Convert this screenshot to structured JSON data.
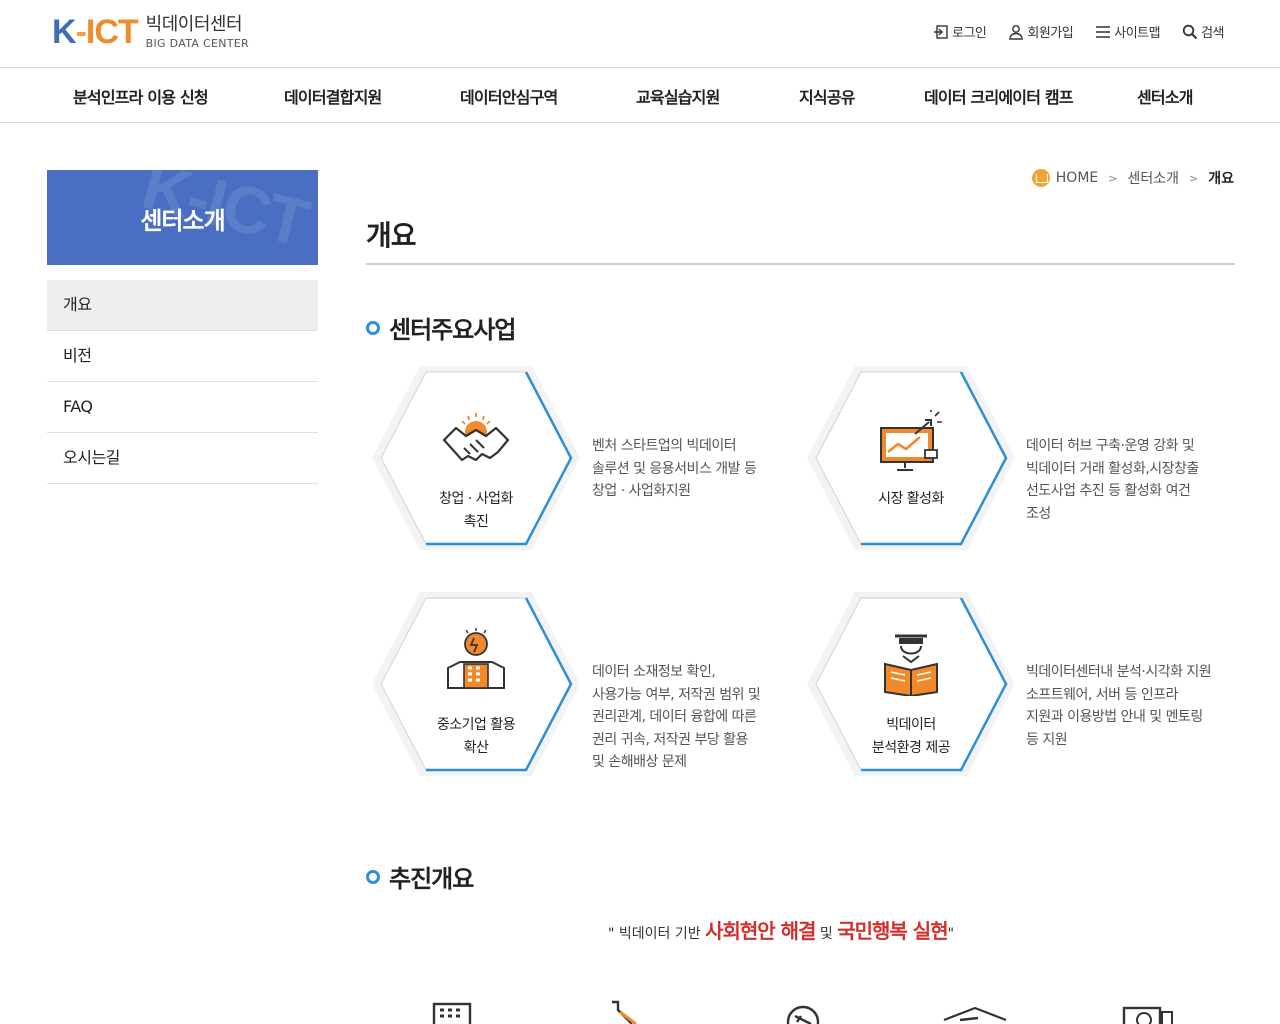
{
  "header": {
    "logo_mark": {
      "k": "K",
      "dash": "-",
      "ict": "ICT"
    },
    "logo_ko": "빅데이터센터",
    "logo_en": "BIG DATA CENTER",
    "util": [
      {
        "label": "로그인",
        "icon": "login-icon"
      },
      {
        "label": "회원가입",
        "icon": "user-icon"
      },
      {
        "label": "사이트맵",
        "icon": "menu-icon"
      },
      {
        "label": "검색",
        "icon": "search-icon"
      }
    ]
  },
  "gnb": [
    "분석인프라 이용 신청",
    "데이터결합지원",
    "데이터안심구역",
    "교육실습지원",
    "지식공유",
    "데이터 크리에이터 캠프",
    "센터소개"
  ],
  "sidebar": {
    "title": "센터소개",
    "watermark": "K-ICT",
    "items": [
      "개요",
      "비전",
      "FAQ",
      "오시는길"
    ]
  },
  "breadcrumb": {
    "home": "HOME",
    "parent": "센터소개",
    "current": "개요"
  },
  "page_title": "개요",
  "section1": {
    "title": "센터주요사업",
    "cards": [
      {
        "label1": "창업 · 사업화",
        "label2": "촉진",
        "icon": "handshake-icon",
        "desc": [
          "벤처 스타트업의 빅데이터",
          "솔루션 및 응용서비스 개발 등",
          "창업 · 사업화지원"
        ]
      },
      {
        "label1": "시장 활성화",
        "label2": "",
        "icon": "growth-chart-icon",
        "desc": [
          "데이터 허브 구축·운영 강화 및",
          "빅데이터 거래 활성화,시장창출",
          "선도사업 추진 등 활성화 여건",
          "조성"
        ]
      },
      {
        "label1": "중소기업 활용",
        "label2": "확산",
        "icon": "building-idea-icon",
        "desc": [
          "데이터 소재정보 확인,",
          "사용가능 여부, 저작권 범위 및",
          "권리관계, 데이터 융합에 따른",
          "권리 귀속, 저작권 부당 활용",
          "및 손해배상 문제"
        ]
      },
      {
        "label1": "빅데이터",
        "label2": "분석환경 제공",
        "icon": "graduate-book-icon",
        "desc": [
          "빅데이터센터내 분석·시각화 지원",
          "소프트웨어, 서버 등 인프라",
          "지원과 이용방법 안내 및 멘토링",
          "등 지원"
        ]
      }
    ]
  },
  "section2": {
    "title": "추진개요",
    "slogan": {
      "q1": "\" ",
      "pre": "빅데이터 기반 ",
      "red1": "사회현안 해결",
      "mid": " 및 ",
      "red2": "국민행복 실현",
      "q2": "\""
    }
  },
  "colors": {
    "accent": "#2f8fd6",
    "sidebar": "#4a6fc2",
    "orange": "#f08a2a",
    "red": "#d0312d"
  }
}
